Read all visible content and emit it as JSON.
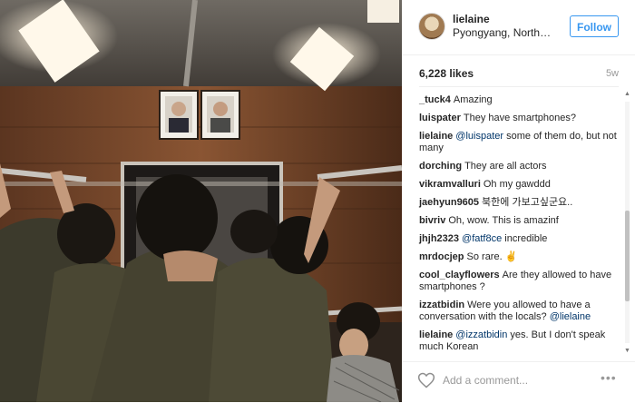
{
  "post": {
    "username": "lielaine",
    "location": "Pyongyang, North Korea",
    "follow_label": "Follow",
    "likes": "6,228 likes",
    "time_ago": "5w",
    "add_comment_placeholder": "Add a comment...",
    "more_label": "•••"
  },
  "comments": [
    {
      "user": "_tuck4",
      "mention": "",
      "text": "Amazing"
    },
    {
      "user": "luispater",
      "mention": "",
      "text": "They have smartphones?"
    },
    {
      "user": "lielaine",
      "mention": "@luispater",
      "text": "some of them do, but not many"
    },
    {
      "user": "dorching",
      "mention": "",
      "text": "They are all actors"
    },
    {
      "user": "vikramvalluri",
      "mention": "",
      "text": "Oh my gawddd"
    },
    {
      "user": "jaehyun9605",
      "mention": "",
      "text": "북한에 가보고싶군요.."
    },
    {
      "user": "bivriv",
      "mention": "",
      "text": "Oh, wow. This is amazinf"
    },
    {
      "user": "jhjh2323",
      "mention": "@fatf8ce",
      "text": "incredible"
    },
    {
      "user": "mrdocjep",
      "mention": "",
      "text": "So rare. ✌"
    },
    {
      "user": "cool_clayflowers",
      "mention": "",
      "text": "Are they allowed to have smartphones ?"
    },
    {
      "user": "izzatbidin",
      "mention": "",
      "text": "Were you allowed to have a conversation with the locals?",
      "mention_after": "@lielaine"
    },
    {
      "user": "lielaine",
      "mention": "@izzatbidin",
      "text": "yes. But I don't speak much Korean"
    }
  ],
  "colors": {
    "accent": "#3897f0",
    "mention": "#003569",
    "muted": "#999999"
  },
  "icons": {
    "heart": "heart-icon",
    "more": "more-icon",
    "scroll_up": "scroll-up-icon",
    "scroll_down": "scroll-down-icon"
  }
}
